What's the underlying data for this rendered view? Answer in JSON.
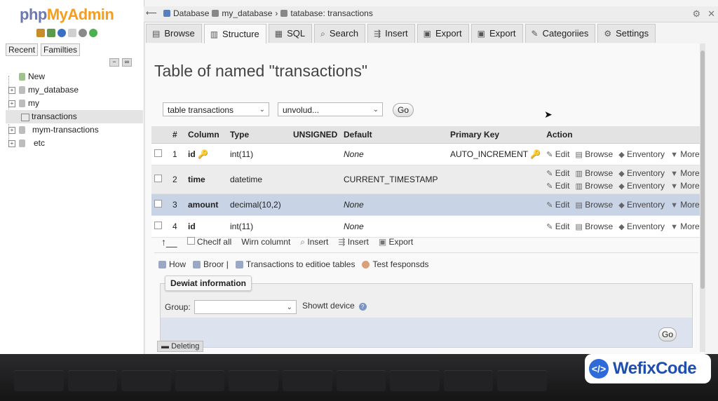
{
  "logo": {
    "php": "php",
    "my": "MyAdmin"
  },
  "sidebar": {
    "tabs": [
      "Recent",
      "Familties"
    ],
    "tree": [
      {
        "label": "New",
        "type": "new"
      },
      {
        "label": "my_database",
        "type": "db"
      },
      {
        "label": "my",
        "type": "db"
      },
      {
        "label": "transactions",
        "type": "table",
        "active": true
      },
      {
        "label": "mym-transactions",
        "type": "db"
      },
      {
        "label": "etc",
        "type": "db"
      }
    ]
  },
  "breadcrumb": {
    "server": "Database",
    "database": "my_database",
    "table": "tatabase: transactions",
    "sep": "›"
  },
  "tabs": [
    {
      "label": "Browse",
      "icon": "▤"
    },
    {
      "label": "Structure",
      "icon": "▥",
      "active": true
    },
    {
      "label": "SQL",
      "icon": "▦"
    },
    {
      "label": "Search",
      "icon": "⌕"
    },
    {
      "label": "Insert",
      "icon": "⇶"
    },
    {
      "label": "Export",
      "icon": "▣"
    },
    {
      "label": "Export",
      "icon": "▣"
    },
    {
      "label": "Categoriies",
      "icon": "✎"
    },
    {
      "label": "Settings",
      "icon": "⚙"
    }
  ],
  "page": {
    "title": "Table of named \"transactions\"",
    "select1": "table transactions",
    "select2": "unvolud...",
    "go": "Go"
  },
  "table": {
    "headers": [
      "#",
      "Column",
      "Type",
      "UNSIGNED",
      "Default",
      "Primary Key",
      "Action"
    ],
    "rows": [
      {
        "num": "1",
        "name": "id",
        "key": true,
        "type": "int(11)",
        "unsigned": "",
        "default": "None",
        "pk": "AUTO_INCREMENT",
        "actions": [
          [
            "Edit",
            "Browse",
            "Enventory",
            "More"
          ]
        ]
      },
      {
        "num": "2",
        "name": "time",
        "key": false,
        "type": "datetime",
        "unsigned": "",
        "default": "CURRENT_TIMESTAMP",
        "pk": "",
        "actions": [
          [
            "Edit",
            "Browse",
            "Enventory",
            "More"
          ],
          [
            "Edit",
            "Browse",
            "Enventory",
            "More"
          ]
        ]
      },
      {
        "num": "3",
        "name": "amount",
        "key": false,
        "type": "decimal(10,2)",
        "unsigned": "",
        "default": "None",
        "pk": "",
        "actions": [
          [
            "Edit",
            "Browse",
            "Enventory",
            "More"
          ]
        ]
      },
      {
        "num": "4",
        "name": "id",
        "key": false,
        "type": "int(11)",
        "unsigned": "",
        "default": "None",
        "pk": "",
        "actions": [
          [
            "Edit",
            "Browse",
            "Enventory",
            "More"
          ]
        ]
      }
    ]
  },
  "bottom_actions": {
    "check_all": "Checlf all",
    "with_columns": "Wirn columnt",
    "insert1": "Insert",
    "insert2": "Insert",
    "export": "Export"
  },
  "links": {
    "how": "How",
    "broor": "Broor |",
    "transactions": "Transactions to editioe tables",
    "test": "Test fesponsds"
  },
  "fieldset": {
    "legend": "Dewiat information",
    "group_label": "Group:",
    "show_label": "Showtt device",
    "go": "Go"
  },
  "deleting": "Deleting",
  "badge": {
    "text": "WefixCode",
    "icon": "</>"
  }
}
